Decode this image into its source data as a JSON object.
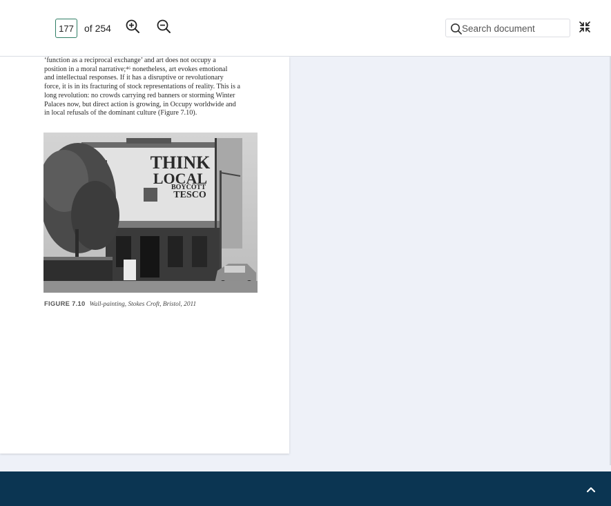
{
  "toolbar": {
    "page_number": "177",
    "page_total": "of 254",
    "zoom_in_icon": "zoom-in-icon",
    "zoom_out_icon": "zoom-out-icon",
    "search_placeholder": "Search document",
    "exit_fullscreen_icon": "collapse-icon"
  },
  "page": {
    "body_lines": [
      "‘function as a reciprocal exchange’ and art does not occupy a",
      "position in a moral narrative;⁴⁶ nonetheless, art evokes emotional",
      "and intellectual responses. If it has a disruptive or revolutionary",
      "force, it is in its fracturing of stock representations of reality. This is a",
      "long revolution: no crowds carrying red banners or storming Winter",
      "Palaces now, but direct action is growing, in Occupy worldwide and",
      "in local refusals of the dominant culture (Figure 7.10)."
    ],
    "figure": {
      "sign_text": [
        "THINK",
        "LOCAL",
        "BOYCOTT",
        "TESCO"
      ],
      "caption_label": "FIGURE 7.10",
      "caption_text": "Wall-painting, Stokes Croft, Bristol, 2011"
    }
  },
  "footer": {
    "scroll_top_icon": "chevron-up-icon"
  },
  "colors": {
    "footer_bg": "#0b3552",
    "viewer_bg": "#eef1f8",
    "page_input_border": "#2e7d64"
  }
}
